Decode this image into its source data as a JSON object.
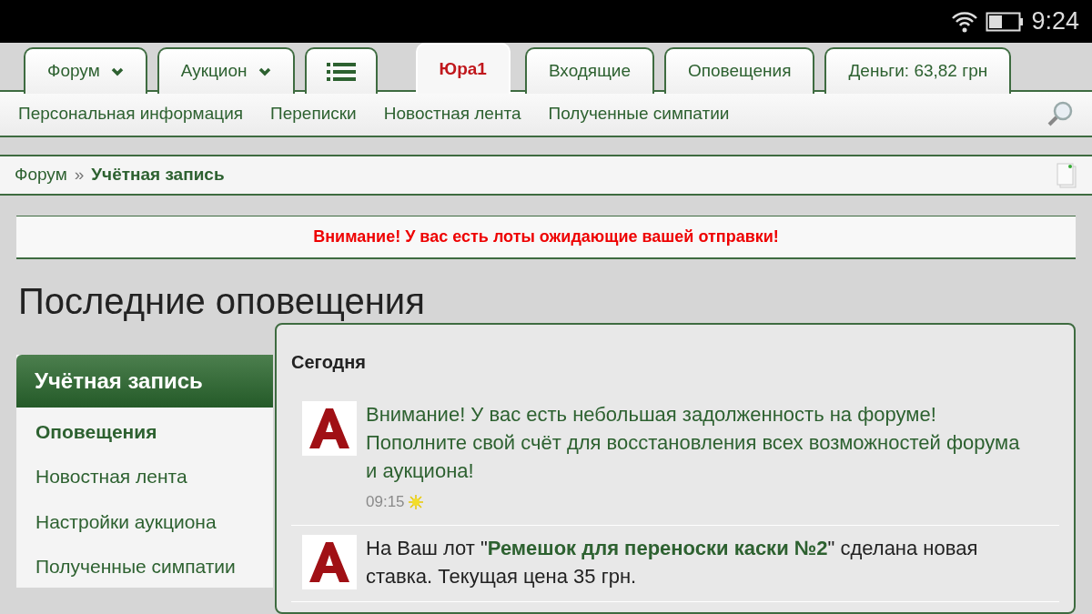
{
  "status_bar": {
    "time": "9:24"
  },
  "tabs": [
    {
      "kind": "dropdown",
      "label": "Форум",
      "selected": false
    },
    {
      "kind": "dropdown",
      "label": "Аукцион",
      "selected": false
    },
    {
      "kind": "icon",
      "selected": false
    },
    {
      "kind": "plain",
      "label": "Юра1",
      "selected": true
    },
    {
      "kind": "plain",
      "label": "Входящие",
      "selected": false
    },
    {
      "kind": "plain",
      "label": "Оповещения",
      "selected": false
    },
    {
      "kind": "plain",
      "label": "Деньги: 63,82 грн",
      "selected": false
    }
  ],
  "subnav": [
    "Персональная информация",
    "Переписки",
    "Новостная лента",
    "Полученные симпатии"
  ],
  "breadcrumb": [
    {
      "label": "Форум",
      "current": false
    },
    {
      "label": "Учётная запись",
      "current": true
    }
  ],
  "breadcrumb_separator": "»",
  "alert": "Внимание! У вас есть лоты ожидающие вашей отправки!",
  "page_title": "Последние оповещения",
  "sidebar": {
    "title": "Учётная запись",
    "items": [
      {
        "label": "Оповещения",
        "selected": true
      },
      {
        "label": "Новостная лента",
        "selected": false
      },
      {
        "label": "Настройки аукциона",
        "selected": false
      },
      {
        "label": "Полученные симпатии",
        "selected": false
      }
    ]
  },
  "panel": {
    "heading": "Сегодня",
    "notifications": [
      {
        "kind": "link",
        "text": "Внимание! У вас есть небольшая задолженность на форуме! Пополните свой счёт для восстановления всех возможностей форума и аукциона!",
        "time": "09:15",
        "new": true
      },
      {
        "kind": "text",
        "text": "На Ваш лот \"**Ремешок для переноски каски №2**\" сделана новая ставка. Текущая цена 35 грн.",
        "new": false
      }
    ]
  }
}
